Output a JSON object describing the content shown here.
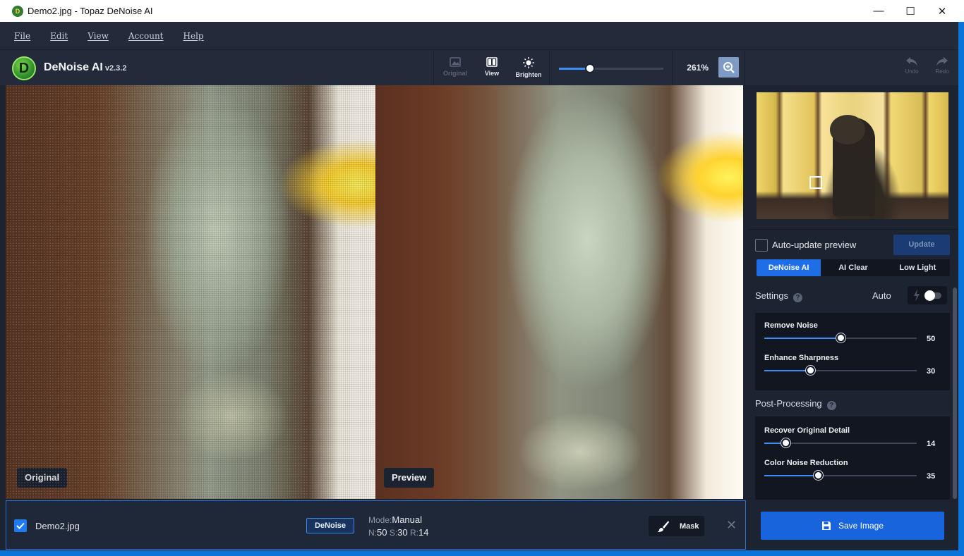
{
  "window": {
    "title": "Demo2.jpg - Topaz DeNoise AI",
    "minimize": "—",
    "maximize": "☐",
    "close": "✕"
  },
  "menu": [
    "File",
    "Edit",
    "View",
    "Account",
    "Help"
  ],
  "brand": {
    "name": "DeNoise AI",
    "version": "v2.3.2",
    "logo_letter": "D"
  },
  "toolbar": {
    "original": "Original",
    "view": "View",
    "brighten": "Brighten",
    "zoom": "261%",
    "zoom_fraction": 0.3,
    "undo": "Undo",
    "redo": "Redo"
  },
  "panels": {
    "left_label": "Original",
    "right_label": "Preview"
  },
  "filebar": {
    "checked": true,
    "filename": "Demo2.jpg",
    "model_badge": "DeNoise",
    "mode_label": "Mode:",
    "mode_value": "Manual",
    "n_label": "N:",
    "n_value": "50",
    "s_label": "S:",
    "s_value": "30",
    "r_label": "R:",
    "r_value": "14",
    "mask_label": "Mask",
    "close": "✕"
  },
  "sidebar": {
    "auto_update_label": "Auto-update preview",
    "auto_update_checked": false,
    "update_button": "Update",
    "tabs": [
      "DeNoise AI",
      "AI Clear",
      "Low Light"
    ],
    "active_tab": 0,
    "settings_title": "Settings",
    "auto_label": "Auto",
    "help_glyph": "?",
    "settings_sliders": [
      {
        "name": "Remove Noise",
        "value": 50
      },
      {
        "name": "Enhance Sharpness",
        "value": 30
      }
    ],
    "post_title": "Post-Processing",
    "post_sliders": [
      {
        "name": "Recover Original Detail",
        "value": 14
      },
      {
        "name": "Color Noise Reduction",
        "value": 35
      }
    ],
    "save_button": "Save Image"
  },
  "colors": {
    "accent": "#1e6ee8",
    "background": "#1c2331",
    "card": "#111620",
    "window_border": "#0a74da"
  }
}
